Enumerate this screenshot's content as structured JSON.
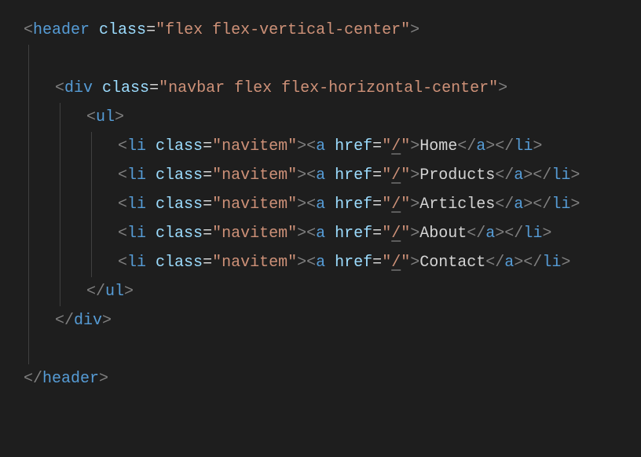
{
  "code": {
    "lines": [
      {
        "indent": 0,
        "parts": [
          {
            "type": "bracket",
            "text": "<"
          },
          {
            "type": "tagname",
            "text": "header"
          },
          {
            "type": "space",
            "text": " "
          },
          {
            "type": "attrname",
            "text": "class"
          },
          {
            "type": "eq",
            "text": "="
          },
          {
            "type": "attrvalue",
            "text": "\"flex flex-vertical-center\""
          },
          {
            "type": "bracket",
            "text": ">"
          }
        ]
      },
      {
        "indent": 0,
        "parts": [],
        "blank": true
      },
      {
        "indent": 1,
        "parts": [
          {
            "type": "bracket",
            "text": "<"
          },
          {
            "type": "tagname",
            "text": "div"
          },
          {
            "type": "space",
            "text": " "
          },
          {
            "type": "attrname",
            "text": "class"
          },
          {
            "type": "eq",
            "text": "="
          },
          {
            "type": "attrvalue",
            "text": "\"navbar flex flex-horizontal-center\""
          },
          {
            "type": "bracket",
            "text": ">"
          }
        ]
      },
      {
        "indent": 2,
        "parts": [
          {
            "type": "bracket",
            "text": "<"
          },
          {
            "type": "tagname",
            "text": "ul"
          },
          {
            "type": "bracket",
            "text": ">"
          }
        ]
      },
      {
        "indent": 3,
        "parts": [
          {
            "type": "bracket",
            "text": "<"
          },
          {
            "type": "tagname",
            "text": "li"
          },
          {
            "type": "space",
            "text": " "
          },
          {
            "type": "attrname",
            "text": "class"
          },
          {
            "type": "eq",
            "text": "="
          },
          {
            "type": "attrvalue",
            "text": "\"navitem\""
          },
          {
            "type": "bracket",
            "text": "><"
          },
          {
            "type": "tagname",
            "text": "a"
          },
          {
            "type": "space",
            "text": " "
          },
          {
            "type": "attrname",
            "text": "href"
          },
          {
            "type": "eq",
            "text": "="
          },
          {
            "type": "attrvalue",
            "text": "\""
          },
          {
            "type": "attrvalue-u",
            "text": "/"
          },
          {
            "type": "attrvalue",
            "text": "\""
          },
          {
            "type": "bracket",
            "text": ">"
          },
          {
            "type": "content",
            "text": "Home"
          },
          {
            "type": "bracket",
            "text": "</"
          },
          {
            "type": "tagname",
            "text": "a"
          },
          {
            "type": "bracket",
            "text": "></"
          },
          {
            "type": "tagname",
            "text": "li"
          },
          {
            "type": "bracket",
            "text": ">"
          }
        ]
      },
      {
        "indent": 3,
        "parts": [
          {
            "type": "bracket",
            "text": "<"
          },
          {
            "type": "tagname",
            "text": "li"
          },
          {
            "type": "space",
            "text": " "
          },
          {
            "type": "attrname",
            "text": "class"
          },
          {
            "type": "eq",
            "text": "="
          },
          {
            "type": "attrvalue",
            "text": "\"navitem\""
          },
          {
            "type": "bracket",
            "text": "><"
          },
          {
            "type": "tagname",
            "text": "a"
          },
          {
            "type": "space",
            "text": " "
          },
          {
            "type": "attrname",
            "text": "href"
          },
          {
            "type": "eq",
            "text": "="
          },
          {
            "type": "attrvalue",
            "text": "\""
          },
          {
            "type": "attrvalue-u",
            "text": "/"
          },
          {
            "type": "attrvalue",
            "text": "\""
          },
          {
            "type": "bracket",
            "text": ">"
          },
          {
            "type": "content",
            "text": "Products"
          },
          {
            "type": "bracket",
            "text": "</"
          },
          {
            "type": "tagname",
            "text": "a"
          },
          {
            "type": "bracket",
            "text": "></"
          },
          {
            "type": "tagname",
            "text": "li"
          },
          {
            "type": "bracket",
            "text": ">"
          }
        ]
      },
      {
        "indent": 3,
        "parts": [
          {
            "type": "bracket",
            "text": "<"
          },
          {
            "type": "tagname",
            "text": "li"
          },
          {
            "type": "space",
            "text": " "
          },
          {
            "type": "attrname",
            "text": "class"
          },
          {
            "type": "eq",
            "text": "="
          },
          {
            "type": "attrvalue",
            "text": "\"navitem\""
          },
          {
            "type": "bracket",
            "text": "><"
          },
          {
            "type": "tagname",
            "text": "a"
          },
          {
            "type": "space",
            "text": " "
          },
          {
            "type": "attrname",
            "text": "href"
          },
          {
            "type": "eq",
            "text": "="
          },
          {
            "type": "attrvalue",
            "text": "\""
          },
          {
            "type": "attrvalue-u",
            "text": "/"
          },
          {
            "type": "attrvalue",
            "text": "\""
          },
          {
            "type": "bracket",
            "text": ">"
          },
          {
            "type": "content",
            "text": "Articles"
          },
          {
            "type": "bracket",
            "text": "</"
          },
          {
            "type": "tagname",
            "text": "a"
          },
          {
            "type": "bracket",
            "text": "></"
          },
          {
            "type": "tagname",
            "text": "li"
          },
          {
            "type": "bracket",
            "text": ">"
          }
        ]
      },
      {
        "indent": 3,
        "parts": [
          {
            "type": "bracket",
            "text": "<"
          },
          {
            "type": "tagname",
            "text": "li"
          },
          {
            "type": "space",
            "text": " "
          },
          {
            "type": "attrname",
            "text": "class"
          },
          {
            "type": "eq",
            "text": "="
          },
          {
            "type": "attrvalue",
            "text": "\"navitem\""
          },
          {
            "type": "bracket",
            "text": "><"
          },
          {
            "type": "tagname",
            "text": "a"
          },
          {
            "type": "space",
            "text": " "
          },
          {
            "type": "attrname",
            "text": "href"
          },
          {
            "type": "eq",
            "text": "="
          },
          {
            "type": "attrvalue",
            "text": "\""
          },
          {
            "type": "attrvalue-u",
            "text": "/"
          },
          {
            "type": "attrvalue",
            "text": "\""
          },
          {
            "type": "bracket",
            "text": ">"
          },
          {
            "type": "content",
            "text": "About"
          },
          {
            "type": "bracket",
            "text": "</"
          },
          {
            "type": "tagname",
            "text": "a"
          },
          {
            "type": "bracket",
            "text": "></"
          },
          {
            "type": "tagname",
            "text": "li"
          },
          {
            "type": "bracket",
            "text": ">"
          }
        ]
      },
      {
        "indent": 3,
        "parts": [
          {
            "type": "bracket",
            "text": "<"
          },
          {
            "type": "tagname",
            "text": "li"
          },
          {
            "type": "space",
            "text": " "
          },
          {
            "type": "attrname",
            "text": "class"
          },
          {
            "type": "eq",
            "text": "="
          },
          {
            "type": "attrvalue",
            "text": "\"navitem\""
          },
          {
            "type": "bracket",
            "text": "><"
          },
          {
            "type": "tagname",
            "text": "a"
          },
          {
            "type": "space",
            "text": " "
          },
          {
            "type": "attrname",
            "text": "href"
          },
          {
            "type": "eq",
            "text": "="
          },
          {
            "type": "attrvalue",
            "text": "\""
          },
          {
            "type": "attrvalue-u",
            "text": "/"
          },
          {
            "type": "attrvalue",
            "text": "\""
          },
          {
            "type": "bracket",
            "text": ">"
          },
          {
            "type": "content",
            "text": "Contact"
          },
          {
            "type": "bracket",
            "text": "</"
          },
          {
            "type": "tagname",
            "text": "a"
          },
          {
            "type": "bracket",
            "text": "></"
          },
          {
            "type": "tagname",
            "text": "li"
          },
          {
            "type": "bracket",
            "text": ">"
          }
        ]
      },
      {
        "indent": 2,
        "parts": [
          {
            "type": "bracket",
            "text": "</"
          },
          {
            "type": "tagname",
            "text": "ul"
          },
          {
            "type": "bracket",
            "text": ">"
          }
        ]
      },
      {
        "indent": 1,
        "parts": [
          {
            "type": "bracket",
            "text": "</"
          },
          {
            "type": "tagname",
            "text": "div"
          },
          {
            "type": "bracket",
            "text": ">"
          }
        ]
      },
      {
        "indent": 0,
        "parts": [],
        "blank": true
      },
      {
        "indent": 0,
        "parts": [
          {
            "type": "bracket",
            "text": "</"
          },
          {
            "type": "tagname",
            "text": "header"
          },
          {
            "type": "bracket",
            "text": ">"
          }
        ]
      }
    ]
  }
}
